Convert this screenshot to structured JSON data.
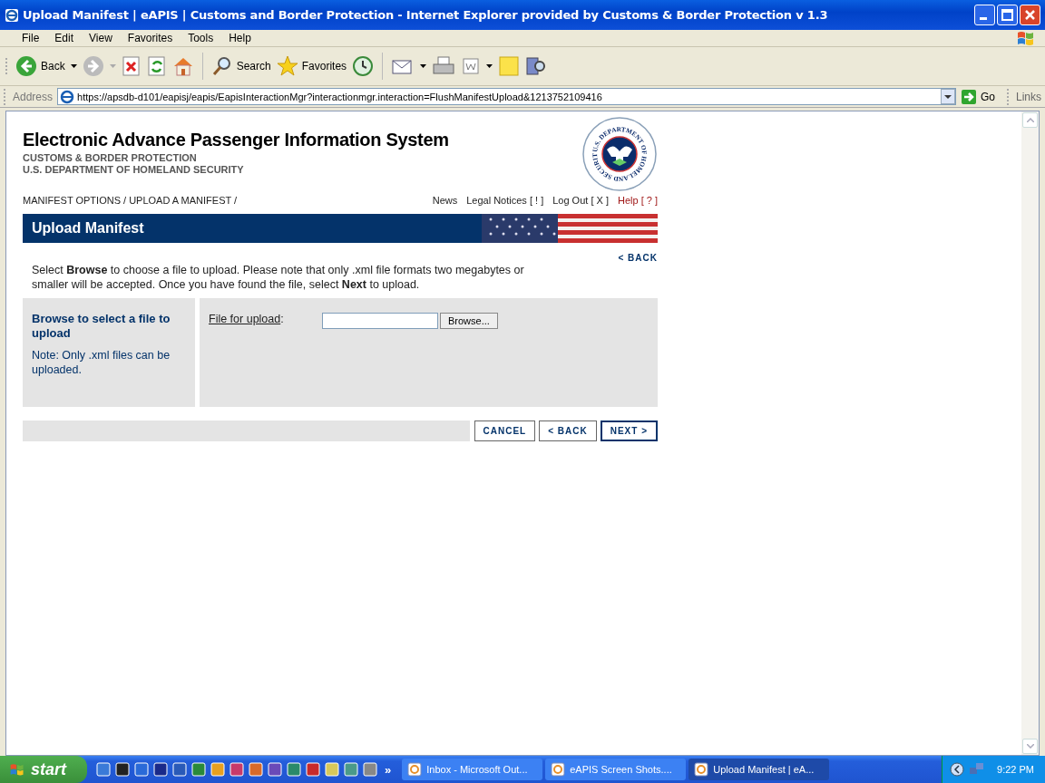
{
  "window": {
    "title": "Upload Manifest | eAPIS | Customs and Border Protection - Internet Explorer provided by Customs & Border Protection v 1.3"
  },
  "menu": [
    {
      "label": "File"
    },
    {
      "label": "Edit"
    },
    {
      "label": "View"
    },
    {
      "label": "Favorites"
    },
    {
      "label": "Tools"
    },
    {
      "label": "Help"
    }
  ],
  "toolbar": {
    "back": "Back",
    "search": "Search",
    "favorites": "Favorites"
  },
  "address": {
    "label": "Address",
    "url": "https://apsdb-d101/eapisj/eapis/EapisInteractionMgr?interactionmgr.interaction=FlushManifestUpload&1213752109416",
    "go": "Go",
    "links": "Links"
  },
  "page": {
    "title": "Electronic Advance Passenger Information System",
    "subtitles": [
      "CUSTOMS & BORDER PROTECTION",
      "U.S. DEPARTMENT OF HOMELAND SECURITY"
    ],
    "seal_text": "U.S. DEPARTMENT OF HOMELAND SECURITY",
    "breadcrumb": "MANIFEST OPTIONS / UPLOAD A MANIFEST /",
    "nav_links": [
      {
        "label": "News",
        "kind": "normal"
      },
      {
        "label": "Legal Notices [ ! ]",
        "kind": "normal"
      },
      {
        "label": "Log Out [ X ]",
        "kind": "normal"
      },
      {
        "label": "Help [ ? ]",
        "kind": "help"
      }
    ],
    "banner": "Upload Manifest",
    "back_link": "< BACK",
    "instructions": "Select **Browse** to choose a file to upload. Please note that only .xml file formats two megabytes or smaller will be accepted. Once you have found the file, select **Next** to upload.",
    "side_panel": {
      "title": "Browse to select a file to upload",
      "note": "Note: Only .xml files can be uploaded."
    },
    "field": {
      "label": "File for upload",
      "suffix": ":",
      "browse": "Browse..."
    },
    "buttons": [
      {
        "label": "CANCEL",
        "default": false
      },
      {
        "label": "< BACK",
        "default": false
      },
      {
        "label": "NEXT >",
        "default": true
      }
    ]
  },
  "taskbar": {
    "start": "start",
    "overflow": "»",
    "tasks": [
      {
        "label": "Inbox - Microsoft Out...",
        "selected": false
      },
      {
        "label": "eAPIS Screen Shots....",
        "selected": false
      },
      {
        "label": "Upload Manifest | eA...",
        "selected": true
      }
    ],
    "clock": "9:22 PM"
  }
}
